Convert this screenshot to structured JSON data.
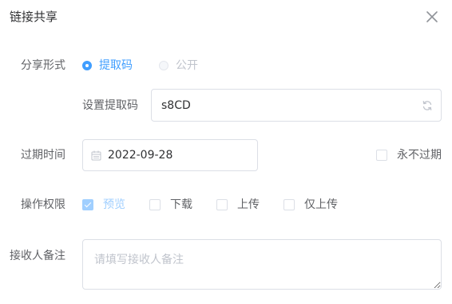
{
  "dialog": {
    "title": "链接共享",
    "close_icon": "close-icon"
  },
  "share_form": {
    "label": "分享形式",
    "options": [
      {
        "label": "提取码",
        "checked": true,
        "disabled": false
      },
      {
        "label": "公开",
        "checked": false,
        "disabled": true
      }
    ]
  },
  "extract_code": {
    "label": "设置提取码",
    "value": "s8CD",
    "refresh_icon": "refresh-icon"
  },
  "expiry": {
    "label": "过期时间",
    "date": "2022-09-28",
    "calendar_icon": "calendar-icon",
    "never_expire_label": "永不过期",
    "never_expire_checked": false
  },
  "permissions": {
    "label": "操作权限",
    "items": [
      {
        "label": "预览",
        "checked": true,
        "disabled": true
      },
      {
        "label": "下载",
        "checked": false,
        "disabled": false
      },
      {
        "label": "上传",
        "checked": false,
        "disabled": false
      },
      {
        "label": "仅上传",
        "checked": false,
        "disabled": false
      }
    ]
  },
  "remark": {
    "label": "接收人备注",
    "placeholder": "请填写接收人备注",
    "value": ""
  },
  "colors": {
    "primary": "#409eff",
    "disabled_primary": "#a0cfff",
    "border": "#dcdfe6",
    "text": "#303133",
    "label_text": "#606266",
    "placeholder": "#c0c4cc"
  }
}
